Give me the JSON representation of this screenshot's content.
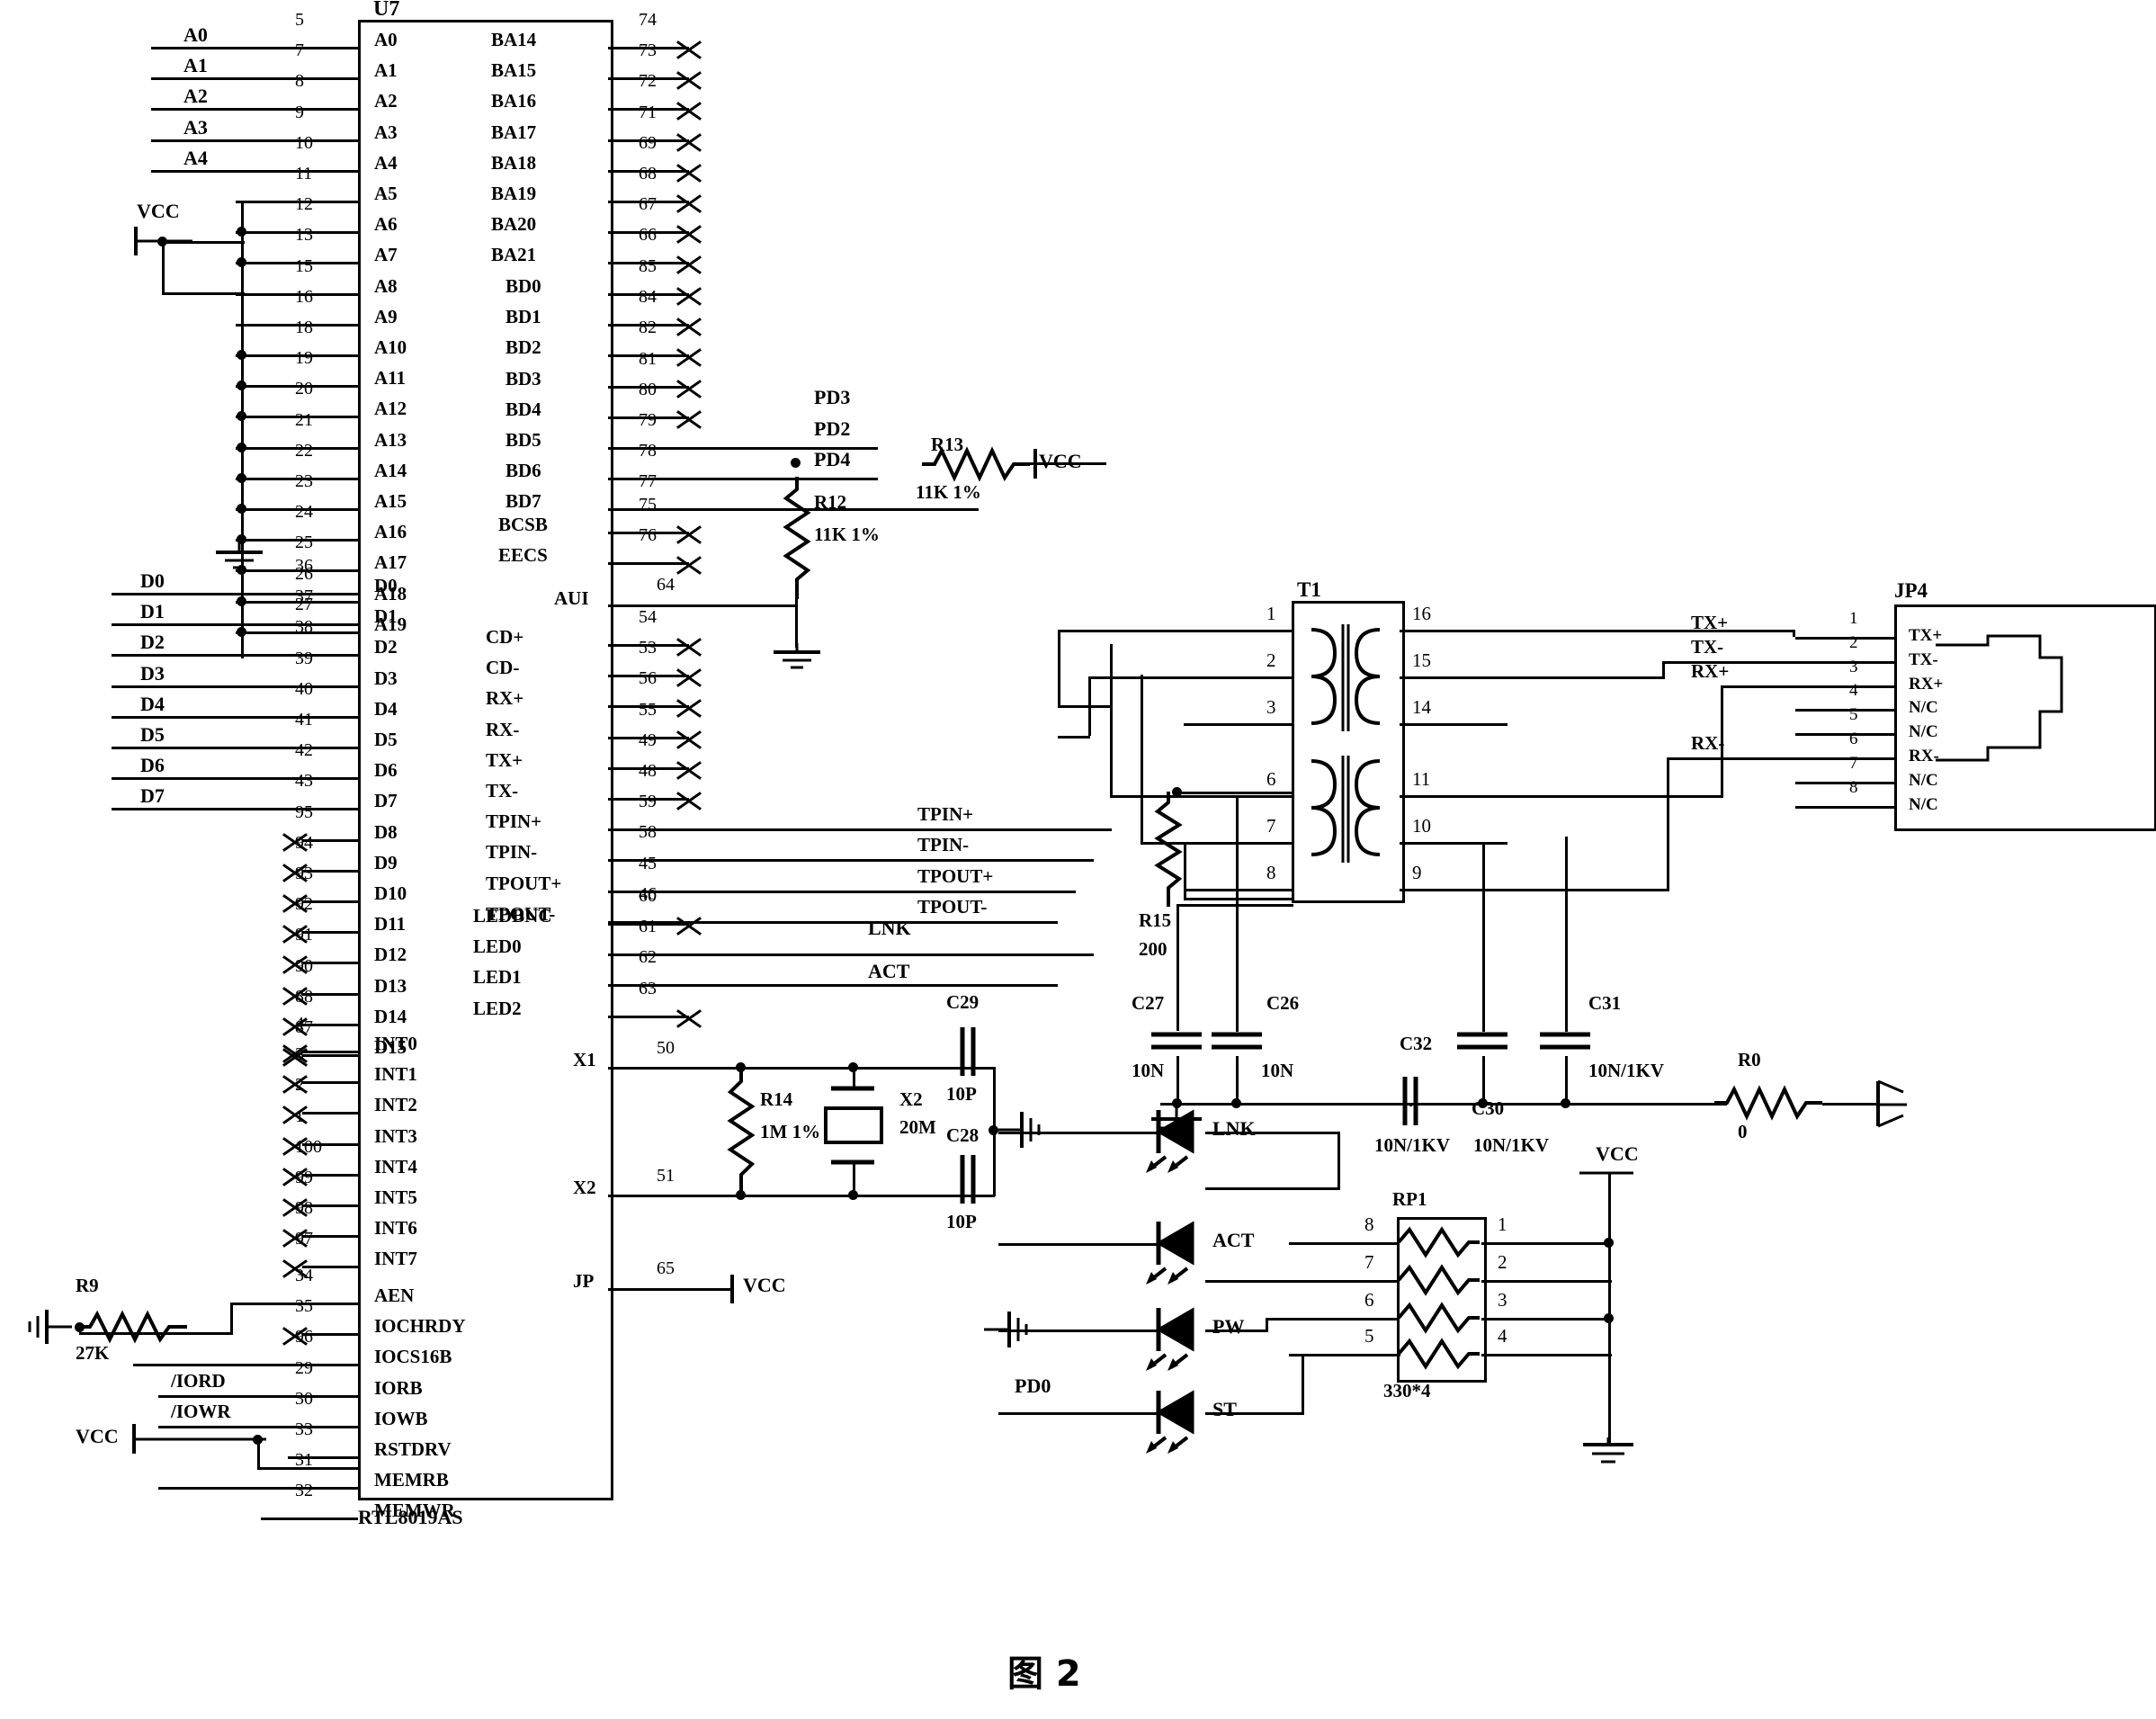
{
  "figure": {
    "caption": "图 2"
  },
  "chip": {
    "ref": "U7",
    "part": "RTL8019AS",
    "left_pins": [
      {
        "name": "A0",
        "pin": "5",
        "net": "A0"
      },
      {
        "name": "A1",
        "pin": "7",
        "net": "A1"
      },
      {
        "name": "A2",
        "pin": "8",
        "net": "A2"
      },
      {
        "name": "A3",
        "pin": "9",
        "net": "A3"
      },
      {
        "name": "A4",
        "pin": "10",
        "net": "A4"
      },
      {
        "name": "A5",
        "pin": "11",
        "net": ""
      },
      {
        "name": "A6",
        "pin": "12",
        "net": ""
      },
      {
        "name": "A7",
        "pin": "13",
        "net": ""
      },
      {
        "name": "A8",
        "pin": "15",
        "net": ""
      },
      {
        "name": "A9",
        "pin": "16",
        "net": ""
      },
      {
        "name": "A10",
        "pin": "18",
        "net": ""
      },
      {
        "name": "A11",
        "pin": "19",
        "net": ""
      },
      {
        "name": "A12",
        "pin": "20",
        "net": ""
      },
      {
        "name": "A13",
        "pin": "21",
        "net": ""
      },
      {
        "name": "A14",
        "pin": "22",
        "net": ""
      },
      {
        "name": "A15",
        "pin": "23",
        "net": ""
      },
      {
        "name": "A16",
        "pin": "24",
        "net": ""
      },
      {
        "name": "A17",
        "pin": "25",
        "net": ""
      },
      {
        "name": "A18",
        "pin": "26",
        "net": ""
      },
      {
        "name": "A19",
        "pin": "27",
        "net": ""
      }
    ],
    "left_data_pins": [
      {
        "name": "D0",
        "pin": "36",
        "net": "D0"
      },
      {
        "name": "D1",
        "pin": "37",
        "net": "D1"
      },
      {
        "name": "D2",
        "pin": "38",
        "net": "D2"
      },
      {
        "name": "D3",
        "pin": "39",
        "net": "D3"
      },
      {
        "name": "D4",
        "pin": "40",
        "net": "D4"
      },
      {
        "name": "D5",
        "pin": "41",
        "net": "D5"
      },
      {
        "name": "D6",
        "pin": "42",
        "net": "D6"
      },
      {
        "name": "D7",
        "pin": "43",
        "net": "D7"
      },
      {
        "name": "D8",
        "pin": "95",
        "net": ""
      },
      {
        "name": "D9",
        "pin": "94",
        "net": ""
      },
      {
        "name": "D10",
        "pin": "93",
        "net": ""
      },
      {
        "name": "D11",
        "pin": "92",
        "net": ""
      },
      {
        "name": "D12",
        "pin": "91",
        "net": ""
      },
      {
        "name": "D13",
        "pin": "90",
        "net": ""
      },
      {
        "name": "D14",
        "pin": "88",
        "net": ""
      },
      {
        "name": "D15",
        "pin": "87",
        "net": ""
      }
    ],
    "left_int_pins": [
      {
        "name": "INT0",
        "pin": "4"
      },
      {
        "name": "INT1",
        "pin": "3"
      },
      {
        "name": "INT2",
        "pin": "2"
      },
      {
        "name": "INT3",
        "pin": "1"
      },
      {
        "name": "INT4",
        "pin": "100"
      },
      {
        "name": "INT5",
        "pin": "99"
      },
      {
        "name": "INT6",
        "pin": "98"
      },
      {
        "name": "INT7",
        "pin": "97"
      }
    ],
    "left_ctrl_pins": [
      {
        "name": "AEN",
        "pin": "34",
        "net": ""
      },
      {
        "name": "IOCHRDY",
        "pin": "35",
        "net": ""
      },
      {
        "name": "IOCS16B",
        "pin": "96",
        "net": ""
      },
      {
        "name": "IORB",
        "pin": "29",
        "net": "/IORD"
      },
      {
        "name": "IOWB",
        "pin": "30",
        "net": "/IOWR"
      },
      {
        "name": "RSTDRV",
        "pin": "33",
        "net": ""
      },
      {
        "name": "MEMRB",
        "pin": "31",
        "net": ""
      },
      {
        "name": "MEMWR",
        "pin": "32",
        "net": ""
      }
    ],
    "right_ba_pins": [
      {
        "name": "BA14",
        "pin": "74"
      },
      {
        "name": "BA15",
        "pin": "73"
      },
      {
        "name": "BA16",
        "pin": "72"
      },
      {
        "name": "BA17",
        "pin": "71"
      },
      {
        "name": "BA18",
        "pin": "69"
      },
      {
        "name": "BA19",
        "pin": "68"
      },
      {
        "name": "BA20",
        "pin": "67"
      },
      {
        "name": "BA21",
        "pin": "66"
      }
    ],
    "right_bd_pins": [
      {
        "name": "BD0",
        "pin": "85",
        "net": ""
      },
      {
        "name": "BD1",
        "pin": "84",
        "net": ""
      },
      {
        "name": "BD2",
        "pin": "82",
        "net": ""
      },
      {
        "name": "BD3",
        "pin": "81",
        "net": ""
      },
      {
        "name": "BD4",
        "pin": "80",
        "net": ""
      },
      {
        "name": "BD5",
        "pin": "79",
        "net": "PD3"
      },
      {
        "name": "BD6",
        "pin": "78",
        "net": "PD2"
      },
      {
        "name": "BD7",
        "pin": "77",
        "net": "PD4"
      }
    ],
    "right_cs_pins": [
      {
        "name": "BCSB",
        "pin": "75"
      },
      {
        "name": "EECS",
        "pin": "76"
      }
    ],
    "right_aui_pin": {
      "name": "AUI",
      "pin": "64"
    },
    "right_analog_pins": [
      {
        "name": "CD+",
        "pin": "54",
        "net": ""
      },
      {
        "name": "CD-",
        "pin": "53",
        "net": ""
      },
      {
        "name": "RX+",
        "pin": "56",
        "net": ""
      },
      {
        "name": "RX-",
        "pin": "55",
        "net": ""
      },
      {
        "name": "TX+",
        "pin": "49",
        "net": ""
      },
      {
        "name": "TX-",
        "pin": "48",
        "net": ""
      },
      {
        "name": "TPIN+",
        "pin": "59",
        "net": "TPIN+"
      },
      {
        "name": "TPIN-",
        "pin": "58",
        "net": "TPIN-"
      },
      {
        "name": "TPOUT+",
        "pin": "45",
        "net": "TPOUT+"
      },
      {
        "name": "TPOUT-",
        "pin": "46",
        "net": "TPOUT-"
      }
    ],
    "right_led_pins": [
      {
        "name": "LEDBNC",
        "pin": "60",
        "net": ""
      },
      {
        "name": "LED0",
        "pin": "61",
        "net": "LNK"
      },
      {
        "name": "LED1",
        "pin": "62",
        "net": "ACT"
      },
      {
        "name": "LED2",
        "pin": "63",
        "net": ""
      }
    ],
    "right_xtal_pins": [
      {
        "name": "X1",
        "pin": "50"
      },
      {
        "name": "X2",
        "pin": "51"
      }
    ],
    "right_jp_pin": {
      "name": "JP",
      "pin": "65",
      "net": "VCC"
    }
  },
  "transformer": {
    "ref": "T1",
    "left_pins": [
      "1",
      "2",
      "3",
      "6",
      "7",
      "8"
    ],
    "right_pins": [
      "16",
      "15",
      "14",
      "11",
      "10",
      "9"
    ]
  },
  "rj45": {
    "ref": "JP4",
    "pins": [
      {
        "num": "1",
        "name": "TX+",
        "net": "TX+"
      },
      {
        "num": "2",
        "name": "TX-",
        "net": "TX-"
      },
      {
        "num": "3",
        "name": "RX+",
        "net": "RX+"
      },
      {
        "num": "4",
        "name": "N/C",
        "net": ""
      },
      {
        "num": "5",
        "name": "N/C",
        "net": ""
      },
      {
        "num": "6",
        "name": "RX-",
        "net": "RX-"
      },
      {
        "num": "7",
        "name": "N/C",
        "net": ""
      },
      {
        "num": "8",
        "name": "N/C",
        "net": ""
      }
    ]
  },
  "resistor_network": {
    "ref": "RP1",
    "value": "330*4",
    "left_pins": [
      "8",
      "7",
      "6",
      "5"
    ],
    "right_pins": [
      "1",
      "2",
      "3",
      "4"
    ]
  },
  "leds": [
    {
      "name": "LNK"
    },
    {
      "name": "ACT"
    },
    {
      "name": "PW"
    },
    {
      "name": "ST"
    }
  ],
  "components": {
    "r0": {
      "ref": "R0",
      "value": "0"
    },
    "r9": {
      "ref": "R9",
      "value": "27K"
    },
    "r12": {
      "ref": "R12",
      "value": "11K 1%"
    },
    "r13": {
      "ref": "R13",
      "value": "11K 1%"
    },
    "r14": {
      "ref": "R14",
      "value": "1M 1%"
    },
    "r15": {
      "ref": "R15",
      "value": "200"
    },
    "c26": {
      "ref": "C26",
      "value": "10N"
    },
    "c27": {
      "ref": "C27",
      "value": "10N"
    },
    "c28": {
      "ref": "C28",
      "value": "10P"
    },
    "c29": {
      "ref": "C29",
      "value": "10P"
    },
    "c30": {
      "ref": "C30",
      "value": "10N/1KV"
    },
    "c31": {
      "ref": "C31",
      "value": "10N/1KV"
    },
    "c32": {
      "ref": "C32",
      "value": "10N/1KV"
    },
    "x2": {
      "ref": "X2",
      "value": "20M"
    }
  },
  "power_labels": {
    "vcc": "VCC",
    "vcc_top": "VCC",
    "vcc_bottom": "VCC",
    "vcc_rp1": "VCC",
    "vcc_jp": "VCC",
    "vcc_r13": "VCC"
  },
  "signal_nets": {
    "pd0": "PD0",
    "lnk": "LNK",
    "act": "ACT"
  }
}
